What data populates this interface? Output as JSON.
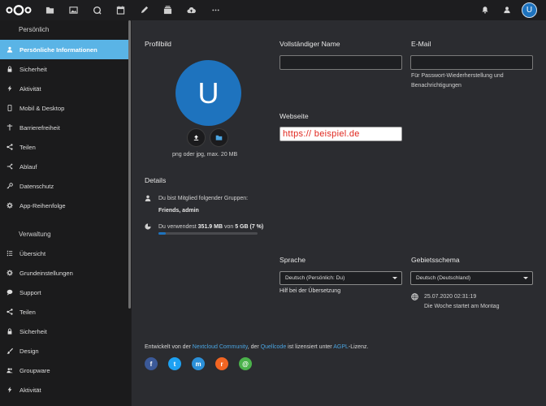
{
  "header": {
    "apps": [
      {
        "name": "files-icon"
      },
      {
        "name": "photos-icon"
      },
      {
        "name": "activity-icon"
      },
      {
        "name": "calendar-icon"
      },
      {
        "name": "notes-icon"
      },
      {
        "name": "deck-icon"
      },
      {
        "name": "cloud-upload-icon"
      },
      {
        "name": "more-apps-icon"
      }
    ],
    "avatar_letter": "U"
  },
  "sidebar": {
    "personal_caption": "Persönlich",
    "personal_items": [
      {
        "label": "Persönliche Informationen",
        "icon": "user-icon",
        "active": true
      },
      {
        "label": "Sicherheit",
        "icon": "lock-icon"
      },
      {
        "label": "Aktivität",
        "icon": "bolt-icon"
      },
      {
        "label": "Mobil & Desktop",
        "icon": "phone-icon"
      },
      {
        "label": "Barrierefreiheit",
        "icon": "accessibility-icon"
      },
      {
        "label": "Teilen",
        "icon": "share-icon"
      },
      {
        "label": "Ablauf",
        "icon": "flow-icon"
      },
      {
        "label": "Datenschutz",
        "icon": "key-icon"
      },
      {
        "label": "App-Reihenfolge",
        "icon": "gear-icon"
      }
    ],
    "admin_caption": "Verwaltung",
    "admin_items": [
      {
        "label": "Übersicht",
        "icon": "list-icon"
      },
      {
        "label": "Grundeinstellungen",
        "icon": "gear-icon"
      },
      {
        "label": "Support",
        "icon": "chat-icon"
      },
      {
        "label": "Teilen",
        "icon": "share-icon"
      },
      {
        "label": "Sicherheit",
        "icon": "lock-icon"
      },
      {
        "label": "Design",
        "icon": "brush-icon"
      },
      {
        "label": "Groupware",
        "icon": "group-icon"
      },
      {
        "label": "Aktivität",
        "icon": "bolt-icon"
      }
    ]
  },
  "profile": {
    "title": "Profilbild",
    "avatar_letter": "U",
    "hint": "png oder jpg, max. 20 MB"
  },
  "fullname": {
    "label": "Vollständiger Name",
    "value": ""
  },
  "email": {
    "label": "E-Mail",
    "value": "",
    "hint_line1": "Für Passwort-Wiederherstellung und",
    "hint_line2": "Benachrichtigungen"
  },
  "website": {
    "label": "Webseite",
    "value": "https:// beispiel.de"
  },
  "details": {
    "title": "Details",
    "groups_text": "Du bist Mitglied folgender Gruppen:",
    "groups_value": "Friends, admin",
    "quota_prefix": "Du verwendest",
    "quota_used": "351.9 MB",
    "quota_mid": "von",
    "quota_total": "5 GB",
    "quota_percent": "(7 %)",
    "quota_fraction": 0.07
  },
  "language": {
    "label": "Sprache",
    "selected": "Deutsch (Persönlich: Du)",
    "help": "Hilf bei der Übersetzung"
  },
  "locale": {
    "label": "Gebietsschema",
    "selected": "Deutsch (Deutschland)",
    "datetime": "25.07.2020 02:31:19",
    "week_start": "Die Woche startet am Montag"
  },
  "footer": {
    "t1": "Entwickelt von der",
    "l1": "Nextcloud Community",
    "t2": ", der",
    "l2": "Quellcode",
    "t3": "ist lizensiert unter",
    "l3": "AGPL",
    "t4": "-Lizenz."
  },
  "social": [
    {
      "name": "facebook-icon",
      "glyph": "f",
      "color": "#3b5998"
    },
    {
      "name": "twitter-icon",
      "glyph": "t",
      "color": "#1da1f2"
    },
    {
      "name": "mastodon-icon",
      "glyph": "m",
      "color": "#2b90d9"
    },
    {
      "name": "rss-icon",
      "glyph": "r",
      "color": "#f26522"
    },
    {
      "name": "mail-icon",
      "glyph": "@",
      "color": "#4bb24b"
    }
  ]
}
